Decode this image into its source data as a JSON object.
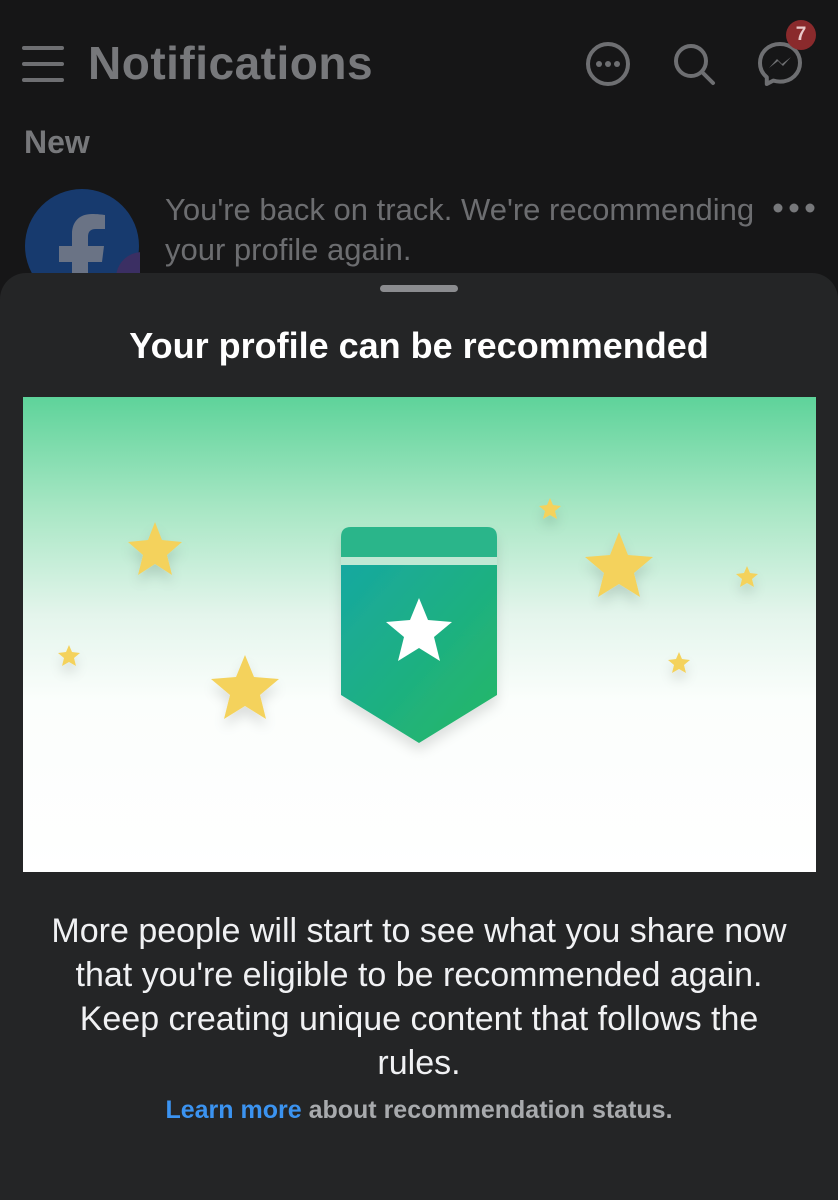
{
  "header": {
    "title": "Notifications",
    "messenger_badge": "7"
  },
  "section": {
    "label": "New"
  },
  "notification": {
    "text": "You're back on track. We're recommending your profile again."
  },
  "sheet": {
    "title": "Your profile can be recommended",
    "body": "More people will start to see what you share now that you're eligible to be recommended again. Keep creating unique content that follows the rules.",
    "link_label": "Learn more",
    "link_suffix": " about recommendation status."
  },
  "colors": {
    "sheet_background": "#242526",
    "link": "#3b93f0",
    "badge": "#8a2a2c"
  },
  "icons": [
    "menu-icon",
    "more-circle-icon",
    "search-icon",
    "messenger-icon",
    "facebook-logo-icon",
    "more-dots-icon",
    "ribbon-star-icon",
    "star-icon"
  ]
}
